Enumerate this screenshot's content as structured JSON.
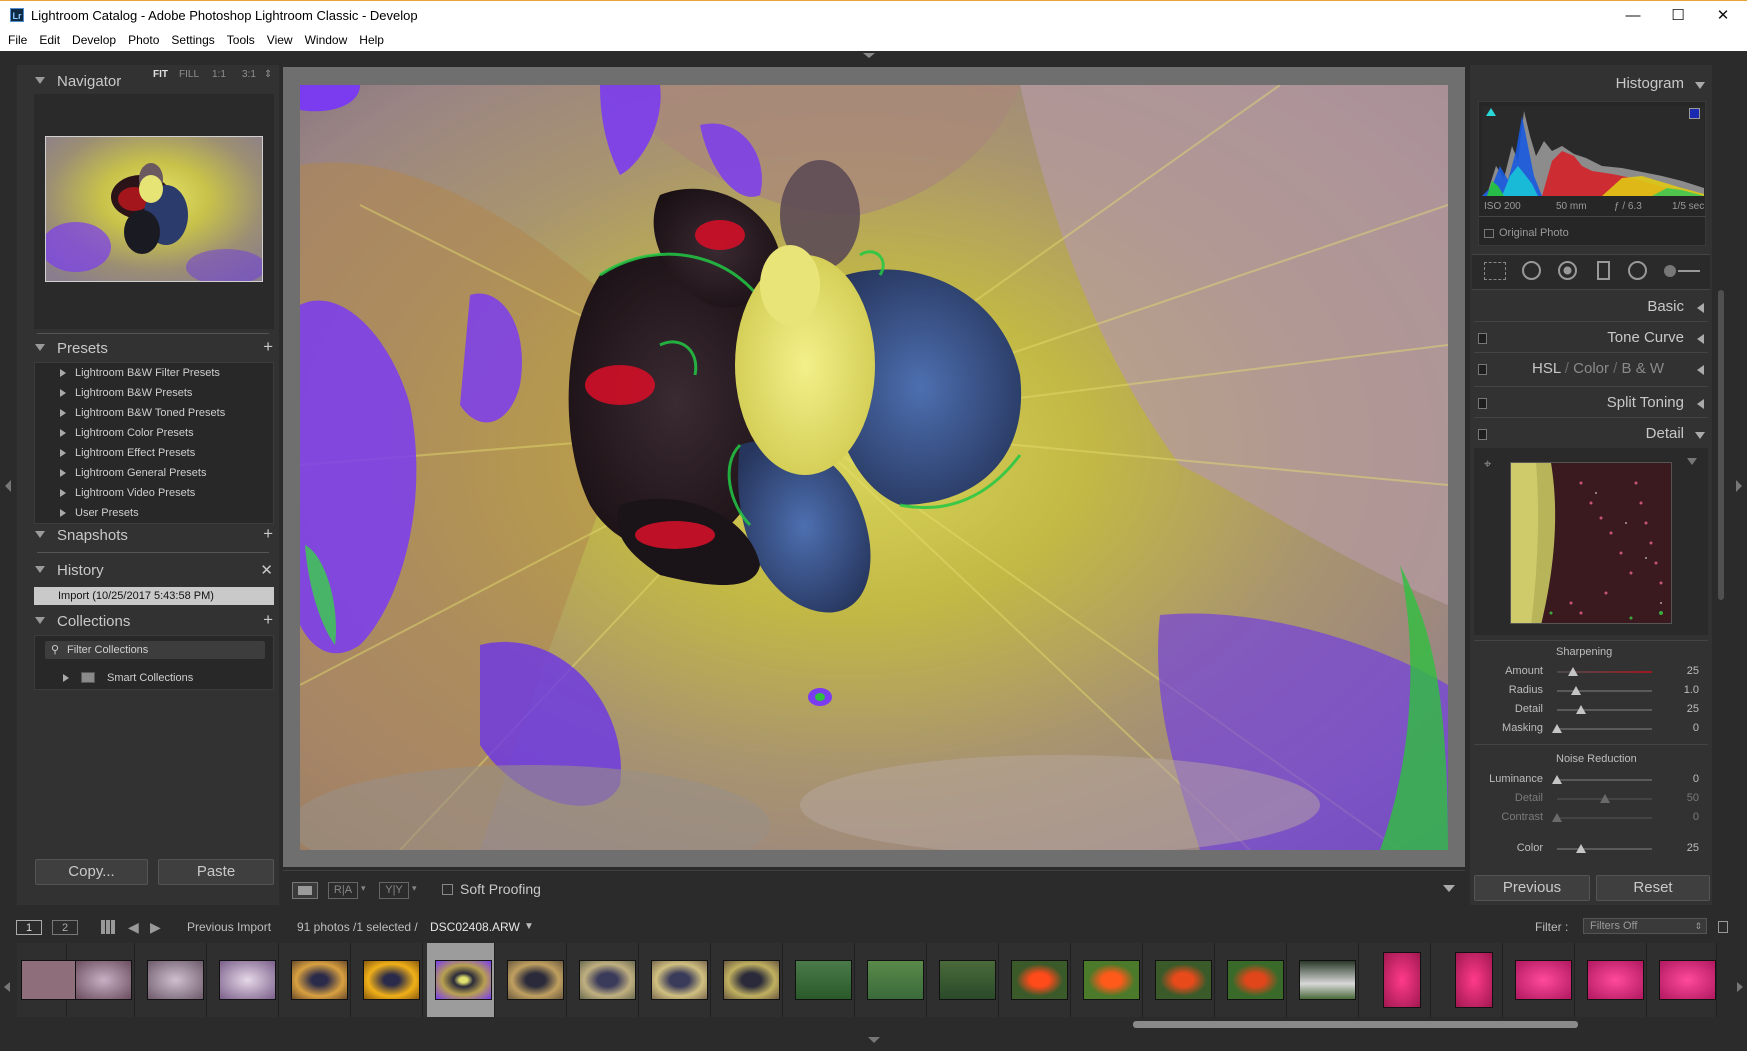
{
  "window": {
    "title": "Lightroom Catalog - Adobe Photoshop Lightroom Classic - Develop",
    "app_icon": "Lr",
    "controls": {
      "minimize": "—",
      "maximize": "☐",
      "close": "✕"
    }
  },
  "menu": [
    "File",
    "Edit",
    "Develop",
    "Photo",
    "Settings",
    "Tools",
    "View",
    "Window",
    "Help"
  ],
  "left": {
    "navigator": {
      "title": "Navigator",
      "zoom_options": [
        "FIT",
        "FILL",
        "1:1",
        "3:1"
      ],
      "active_zoom": "FIT"
    },
    "presets": {
      "title": "Presets",
      "items": [
        "Lightroom B&W Filter Presets",
        "Lightroom B&W Presets",
        "Lightroom B&W Toned Presets",
        "Lightroom Color Presets",
        "Lightroom Effect Presets",
        "Lightroom General Presets",
        "Lightroom Video Presets",
        "User Presets"
      ]
    },
    "snapshots": {
      "title": "Snapshots"
    },
    "history": {
      "title": "History",
      "items": [
        "Import (10/25/2017 5:43:58 PM)"
      ]
    },
    "collections": {
      "title": "Collections",
      "filter_placeholder": "Filter Collections",
      "items": [
        "Smart Collections"
      ]
    },
    "buttons": {
      "copy": "Copy...",
      "paste": "Paste"
    }
  },
  "toolbar": {
    "soft_proofing": "Soft Proofing"
  },
  "right": {
    "histogram": {
      "title": "Histogram",
      "iso": "ISO 200",
      "focal": "50 mm",
      "aperture": "ƒ / 6.3",
      "shutter": "1/5 sec",
      "original_photo": "Original Photo"
    },
    "panels": {
      "basic": "Basic",
      "tone_curve": "Tone Curve",
      "hsl": "HSL",
      "color": "Color",
      "bw": "B & W",
      "split_toning": "Split Toning",
      "detail": "Detail"
    },
    "sharpening": {
      "title": "Sharpening",
      "sliders": [
        {
          "label": "Amount",
          "value": "25",
          "pos": 0.17
        },
        {
          "label": "Radius",
          "value": "1.0",
          "pos": 0.2
        },
        {
          "label": "Detail",
          "value": "25",
          "pos": 0.25
        },
        {
          "label": "Masking",
          "value": "0",
          "pos": 0.0
        }
      ]
    },
    "noise_reduction": {
      "title": "Noise Reduction",
      "sliders": [
        {
          "label": "Luminance",
          "value": "0",
          "pos": 0.0,
          "dim": false
        },
        {
          "label": "Detail",
          "value": "50",
          "pos": 0.5,
          "dim": true
        },
        {
          "label": "Contrast",
          "value": "0",
          "pos": 0.0,
          "dim": true
        },
        {
          "label": "Color",
          "value": "25",
          "pos": 0.25,
          "dim": false
        }
      ]
    },
    "buttons": {
      "previous": "Previous",
      "reset": "Reset"
    }
  },
  "filmstrip": {
    "screen1": "1",
    "screen2": "2",
    "source": "Previous Import",
    "count": "91 photos /1 selected /",
    "filename": "DSC02408.ARW",
    "filter_label": "Filter :",
    "filter_value": "Filters Off",
    "selected_index": 6
  },
  "colors": {
    "panel_bg": "#323232",
    "app_bg": "#2b2b2b",
    "photo_bg": "#6f6f6f",
    "accent_red": "#c0161e"
  }
}
